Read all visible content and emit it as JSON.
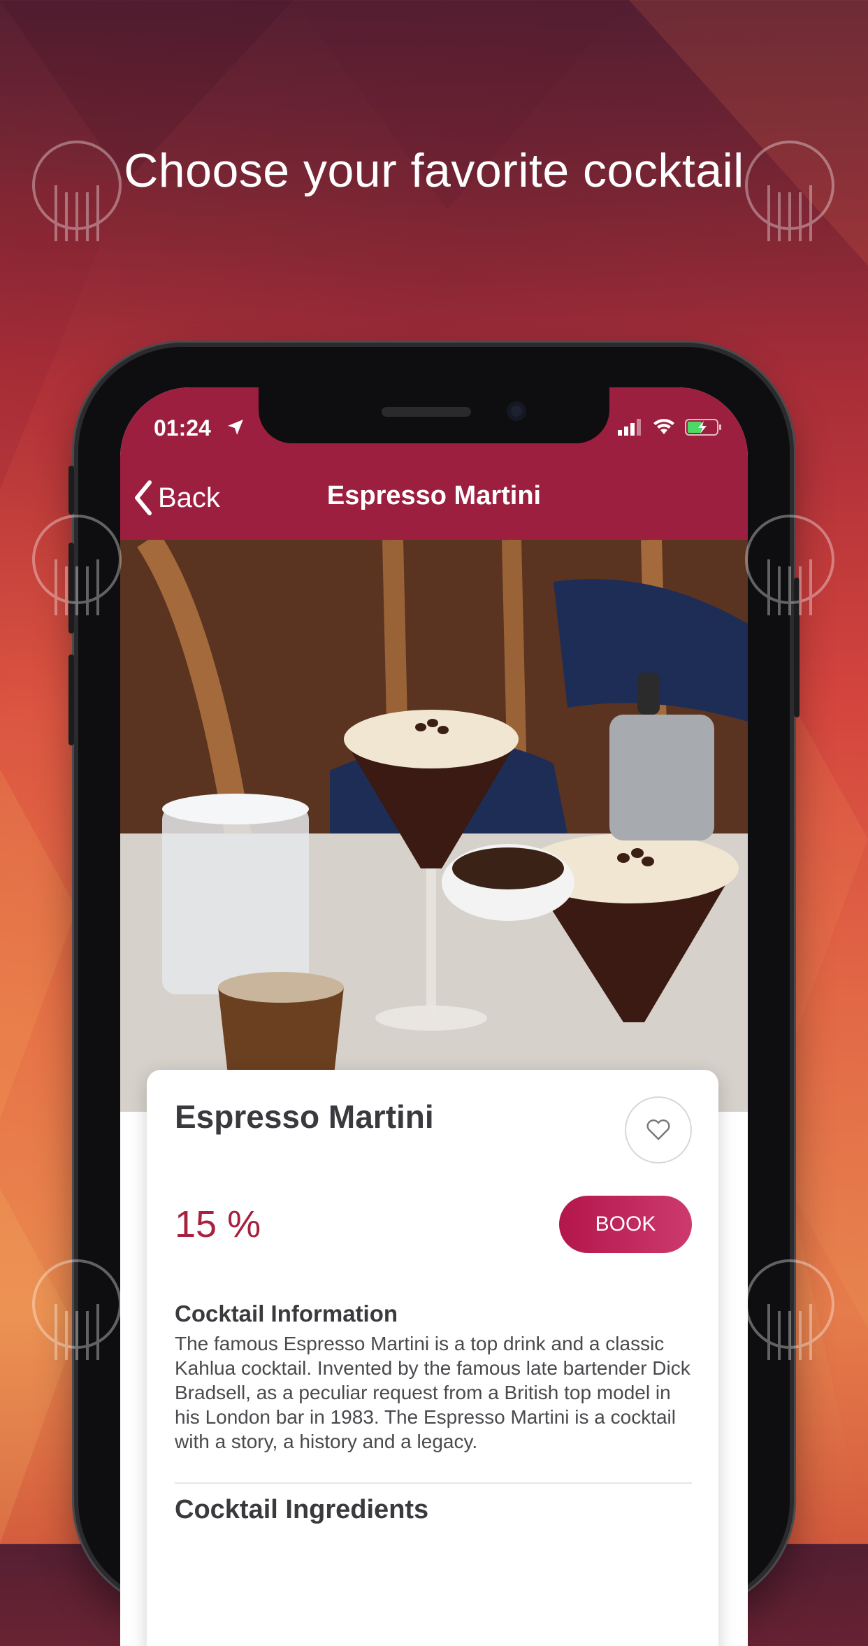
{
  "promo": {
    "title": "Choose your favorite cocktail"
  },
  "status_bar": {
    "time": "01:24"
  },
  "nav": {
    "back_label": "Back",
    "title": "Espresso Martini"
  },
  "carousel": {
    "page_count": 1,
    "active_index": 0
  },
  "card": {
    "title": "Espresso Martini",
    "discount": "15 %",
    "book_label": "BOOK",
    "info_heading": "Cocktail Information",
    "info_text": "The famous Espresso Martini is a top drink and a classic Kahlua cocktail. Invented by the famous late bartender Dick Bradsell, as a peculiar request from a British top model in his London bar in 1983. The Espresso Martini is a cocktail with a story, a history and a legacy.",
    "ingredients_heading": "Cocktail Ingredients"
  },
  "colors": {
    "brand": "#9d1f3f",
    "accent": "#a8213f",
    "book_gradient_start": "#b3164b",
    "book_gradient_end": "#cd3a6e"
  },
  "icons": [
    "location-arrow-icon",
    "signal-icon",
    "wifi-icon",
    "battery-charging-icon",
    "chevron-left-icon",
    "heart-icon"
  ]
}
